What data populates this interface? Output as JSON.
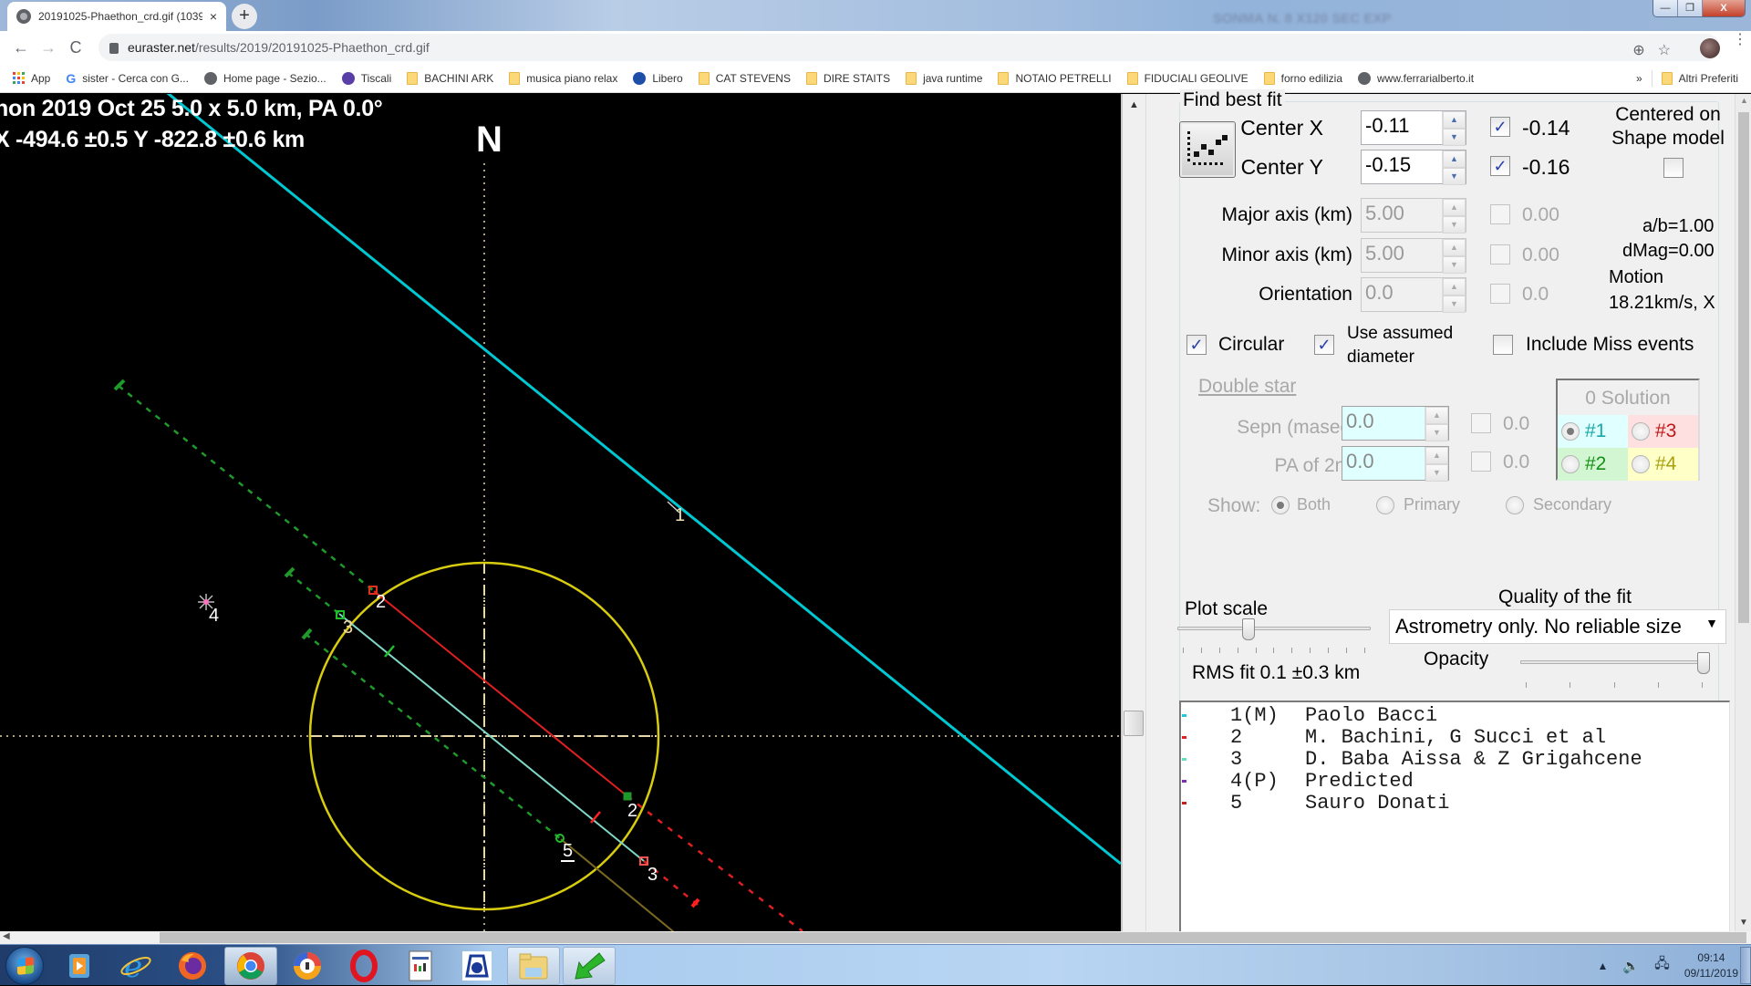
{
  "browser": {
    "tab_title": "20191025-Phaethon_crd.gif (1039",
    "tab_close": "×",
    "new_tab": "+",
    "background_window_text": "SONMA N. 8 X120 SEC EXP",
    "window_controls": {
      "minimize": "—",
      "restore": "❐",
      "close": "X"
    },
    "nav": {
      "back": "←",
      "forward": "→",
      "reload": "C"
    },
    "url_host": "euraster.net",
    "url_path": "/results/2019/20191025-Phaethon_crd.gif",
    "icons": {
      "zoom": "⊕",
      "star": "☆"
    },
    "bookmarks": [
      {
        "label": "App",
        "icon": "apps-icon"
      },
      {
        "label": "sister - Cerca con G...",
        "icon": "google-icon"
      },
      {
        "label": "Home page - Sezio...",
        "icon": "globe-icon"
      },
      {
        "label": "Tiscali",
        "icon": "tiscali-icon"
      },
      {
        "label": "BACHINI ARK",
        "icon": "folder-icon"
      },
      {
        "label": "musica piano relax",
        "icon": "folder-icon"
      },
      {
        "label": "Libero",
        "icon": "libero-icon"
      },
      {
        "label": "CAT STEVENS",
        "icon": "folder-icon"
      },
      {
        "label": "DIRE STAITS",
        "icon": "folder-icon"
      },
      {
        "label": "java runtime",
        "icon": "folder-icon"
      },
      {
        "label": "NOTAIO PETRELLI",
        "icon": "folder-icon"
      },
      {
        "label": "FIDUCIALI GEOLIVE",
        "icon": "folder-icon"
      },
      {
        "label": "forno edilizia",
        "icon": "folder-icon"
      },
      {
        "label": "www.ferrarialberto.it",
        "icon": "globe-icon"
      }
    ],
    "bookmarks_overflow": "»",
    "other_bookmarks": "Altri Preferiti"
  },
  "plot": {
    "caption_line1": "hon  2019 Oct 25   5.0 x 5.0 km,  PA 0.0°",
    "caption_line2": "X  -494.6 ±0.5  Y -822.8 ±0.6 km",
    "north_label": "N",
    "colors": {
      "background": "#000000",
      "chord_1": "#00c8d2",
      "chord_3": "#7fd6c4",
      "chord_2": "#e02020",
      "miss_line": "#1f9a2a",
      "fit_ellipse": "#d8cc10",
      "axes": "#e8d7a8",
      "predicted": "#ff70c0"
    },
    "chord_labels": [
      {
        "id": "label-1",
        "text": "1"
      },
      {
        "id": "label-2a",
        "text": "2"
      },
      {
        "id": "label-2b",
        "text": "2"
      },
      {
        "id": "label-3a",
        "text": "3"
      },
      {
        "id": "label-3b",
        "text": "3"
      },
      {
        "id": "label-4",
        "text": "4"
      },
      {
        "id": "label-5",
        "text": "5"
      }
    ]
  },
  "panel": {
    "group_title": "Find best fit",
    "center_x": {
      "label": "Center X",
      "value": "-0.11",
      "check_value": "-0.14",
      "checked": true
    },
    "center_y": {
      "label": "Center Y",
      "value": "-0.15",
      "check_value": "-0.16",
      "checked": true
    },
    "centered_on": "Centered on",
    "shape_model": "Shape model",
    "major_axis": {
      "label": "Major axis (km)",
      "value": "5.00",
      "check_value": "0.00"
    },
    "minor_axis": {
      "label": "Minor axis (km)",
      "value": "5.00",
      "check_value": "0.00"
    },
    "orientation": {
      "label": "Orientation",
      "value": "0.0",
      "check_value": "0.0"
    },
    "ab_ratio": "a/b=1.00",
    "dmag": "dMag=0.00",
    "motion_label": "Motion",
    "motion_value": "18.21km/s, X",
    "circular": {
      "label": "Circular",
      "checked": true
    },
    "use_assumed_1": "Use assumed",
    "use_assumed_2": "diameter",
    "include_miss": {
      "label": "Include Miss events",
      "checked": false
    },
    "double_star": "Double star",
    "sepn": {
      "label": "Sepn (masec)",
      "value": "0.0",
      "check_value": "0.0"
    },
    "pa2nd": {
      "label": "PA of 2nd",
      "value": "0.0",
      "check_value": "0.0"
    },
    "show_label": "Show:",
    "show_options": [
      "Both",
      "Primary",
      "Secondary"
    ],
    "solution_title": "0 Solution",
    "solutions": [
      {
        "label": "#1",
        "color": "#1aa8a8",
        "bg": "#e0ffff",
        "selected": true
      },
      {
        "label": "#3",
        "color": "#c01818",
        "bg": "#ffe0e0",
        "selected": false
      },
      {
        "label": "#2",
        "color": "#169016",
        "bg": "#d2f5d2",
        "selected": false
      },
      {
        "label": "#4",
        "color": "#a8a010",
        "bg": "#ffffc8",
        "selected": false
      }
    ],
    "plot_scale_label": "Plot scale",
    "plot_scale_value": 0.37,
    "quality_label": "Quality of the fit",
    "quality_value": "Astrometry only. No reliable size",
    "opacity_label": "Opacity",
    "opacity_value": 1.0,
    "rms_fit": "RMS fit 0.1 ±0.3 km",
    "observers": [
      {
        "num": "1(M)",
        "name": "Paolo Bacci",
        "color": "#20c8d8"
      },
      {
        "num": "2",
        "name": "M. Bachini, G Succi et al",
        "color": "#e02020"
      },
      {
        "num": "3",
        "name": "D. Baba Aissa & Z Grigahcene",
        "color": "#60e0c0"
      },
      {
        "num": "4(P)",
        "name": "Predicted",
        "color": "#7a30b0"
      },
      {
        "num": "5",
        "name": "Sauro Donati",
        "color": "#c02020"
      }
    ]
  },
  "taskbar": {
    "time": "09:14",
    "date": "09/11/2019",
    "apps": [
      "windows-media-player",
      "internet-explorer",
      "firefox",
      "chrome",
      "avast-browser",
      "opera",
      "notepad-doc",
      "occult-app",
      "file-explorer",
      "green-arrow-app"
    ]
  }
}
